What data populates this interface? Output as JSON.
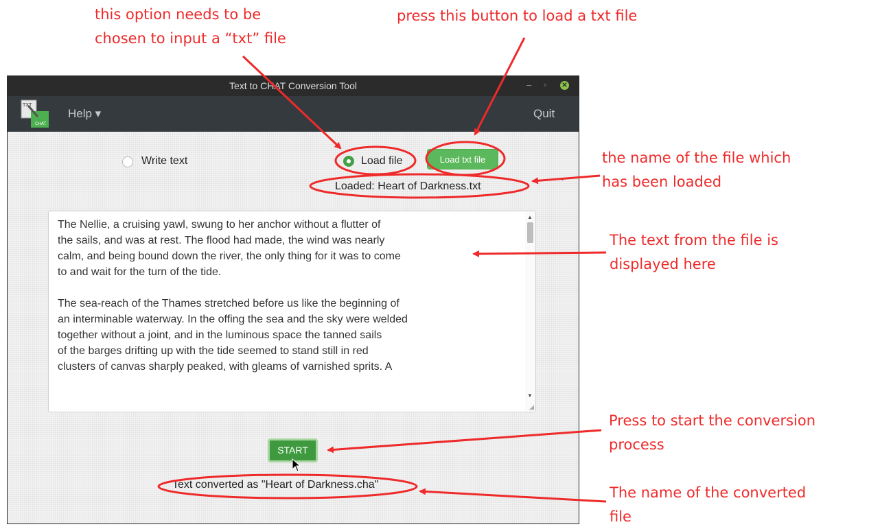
{
  "annotations": {
    "radio_note_line1": "this option needs to be",
    "radio_note_line2": "chosen to input a “txt” file",
    "button_note": "press this button to load a txt file",
    "filename_note_line1": "the name of the file which",
    "filename_note_line2": "has been loaded",
    "text_note_line1": "The text from the file is",
    "text_note_line2": "displayed here",
    "start_note_line1": "Press to start the conversion",
    "start_note_line2": "process",
    "converted_note_line1": "The name of the converted",
    "converted_note_line2": "file",
    "color": "#ee2a2a"
  },
  "window": {
    "title": "Text to CHAT Conversion Tool",
    "minimize": "–",
    "restore": "◦",
    "close": "✕"
  },
  "menubar": {
    "logo_top": "TXT",
    "logo_bottom": "CHAT",
    "help": "Help ▾",
    "quit": "Quit"
  },
  "form": {
    "write_label": "Write text",
    "load_label": "Load file",
    "selected_option": "Load file",
    "load_button": "Load txt file",
    "loaded_status": "Loaded: Heart of Darkness.txt",
    "stray_mark": "`",
    "accent": "#5cb85c"
  },
  "text_content": {
    "paragraph1": [
      "The Nellie, a cruising yawl, swung to her anchor without a flutter of",
      "the sails, and was at rest. The flood had made, the wind was nearly",
      "calm, and being bound down the river, the only thing for it was to come",
      "to and wait for the turn of the tide."
    ],
    "paragraph2": [
      "The sea-reach of the Thames stretched before us like the beginning of",
      "an interminable waterway. In the offing the sea and the sky were welded",
      "together without a joint, and in the luminous space the tanned sails",
      "of the barges drifting up with the tide seemed to stand still in red",
      "clusters of canvas sharply peaked, with gleams of varnished sprits. A"
    ]
  },
  "actions": {
    "start_button": "START",
    "converted_status": "Text converted as \"Heart of Darkness.cha\""
  }
}
